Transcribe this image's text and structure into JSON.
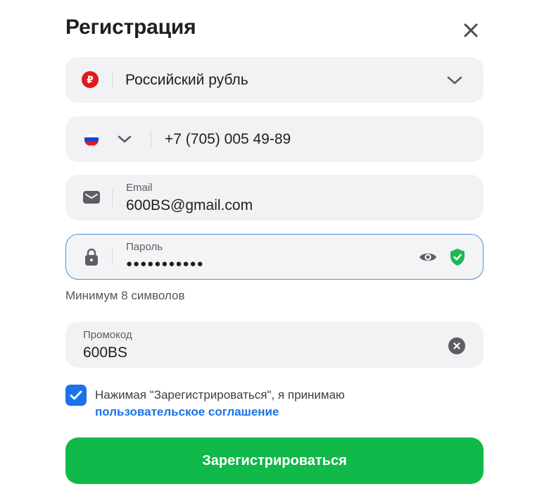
{
  "dialog": {
    "title": "Регистрация"
  },
  "currency": {
    "value": "Российский рубль",
    "icon": "ruble-icon",
    "icon_color": "#e0191e"
  },
  "phone": {
    "value": "+7 (705) 005 49-89",
    "country_flag": "russia-flag-icon"
  },
  "email": {
    "label": "Email",
    "value": "600BS@gmail.com"
  },
  "password": {
    "label": "Пароль",
    "value": "●●●●●●●●●●●",
    "hint": "Минимум 8 символов",
    "focus_color": "#4a90e2",
    "strength_color": "#1db954"
  },
  "promo": {
    "label": "Промокод",
    "value": "600BS"
  },
  "agreement": {
    "checked": true,
    "text": "Нажимая \"Зарегистрироваться\", я принимаю",
    "link": "пользовательское соглашение",
    "link_color": "#1a73e8"
  },
  "submit": {
    "label": "Зарегистрироваться",
    "color": "#11b84a"
  }
}
